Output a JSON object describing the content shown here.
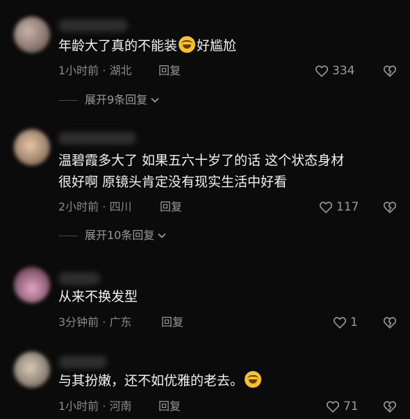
{
  "comments": [
    {
      "text_before": "年龄大了真的不能装",
      "emoji": "laughing-tears-emoji",
      "text_after": "好尴尬",
      "time": "1小时前",
      "location": "湖北",
      "reply": "回复",
      "likes": "334",
      "expand": "展开9条回复"
    },
    {
      "text_line1": "温碧霞多大了 如果五六十岁了的话 这个状态身材",
      "text_line2": "很好啊 原镜头肯定没有现实生活中好看",
      "time": "2小时前",
      "location": "四川",
      "reply": "回复",
      "likes": "117",
      "expand": "展开10条回复"
    },
    {
      "text": "从来不换发型",
      "time": "3分钟前",
      "location": "广东",
      "reply": "回复",
      "likes": "1"
    },
    {
      "text_before": "与其扮嫩，还不如优雅的老去。",
      "emoji": "laughing-tears-emoji",
      "time": "1小时前",
      "location": "河南",
      "reply": "回复",
      "likes": "71"
    }
  ],
  "sep": " · ",
  "colors": {
    "background": "#0b0b0b",
    "text": "#f2f2f2",
    "meta": "#8a8a8a"
  }
}
